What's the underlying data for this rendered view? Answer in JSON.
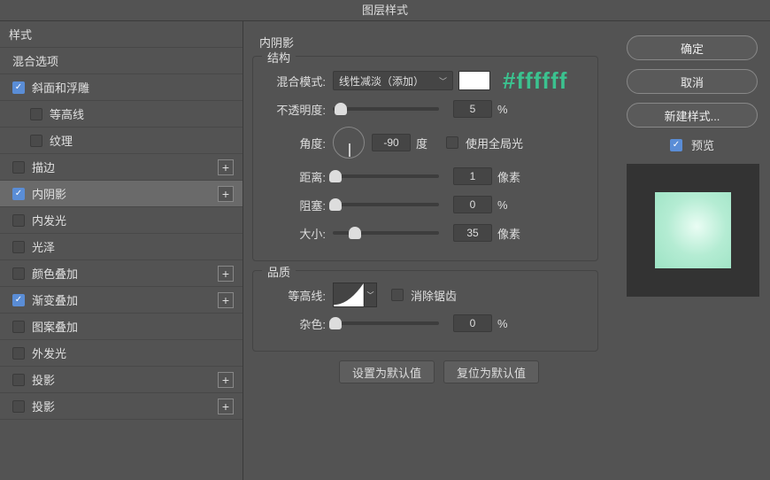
{
  "window_title": "图层样式",
  "sidebar": {
    "header": "样式",
    "blend_options": "混合选项",
    "items": [
      {
        "label": "斜面和浮雕",
        "checked": true,
        "plus": false,
        "sub": false
      },
      {
        "label": "等高线",
        "checked": false,
        "plus": false,
        "sub": true
      },
      {
        "label": "纹理",
        "checked": false,
        "plus": false,
        "sub": true
      },
      {
        "label": "描边",
        "checked": false,
        "plus": true,
        "sub": false
      },
      {
        "label": "内阴影",
        "checked": true,
        "plus": true,
        "sub": false,
        "selected": true
      },
      {
        "label": "内发光",
        "checked": false,
        "plus": false,
        "sub": false
      },
      {
        "label": "光泽",
        "checked": false,
        "plus": false,
        "sub": false
      },
      {
        "label": "颜色叠加",
        "checked": false,
        "plus": true,
        "sub": false
      },
      {
        "label": "渐变叠加",
        "checked": true,
        "plus": true,
        "sub": false
      },
      {
        "label": "图案叠加",
        "checked": false,
        "plus": false,
        "sub": false
      },
      {
        "label": "外发光",
        "checked": false,
        "plus": false,
        "sub": false
      },
      {
        "label": "投影",
        "checked": false,
        "plus": true,
        "sub": false
      },
      {
        "label": "投影",
        "checked": false,
        "plus": true,
        "sub": false
      }
    ]
  },
  "center": {
    "panel_title": "内阴影",
    "structure_title": "结构",
    "blend_mode_label": "混合模式:",
    "blend_mode_value": "线性减淡（添加）",
    "color_hex": "#ffffff",
    "opacity_label": "不透明度:",
    "opacity_value": "5",
    "opacity_unit": "%",
    "angle_label": "角度:",
    "angle_value": "-90",
    "angle_unit": "度",
    "global_light_label": "使用全局光",
    "distance_label": "距离:",
    "distance_value": "1",
    "distance_unit": "像素",
    "spread_label": "阻塞:",
    "spread_value": "0",
    "spread_unit": "%",
    "size_label": "大小:",
    "size_value": "35",
    "size_unit": "像素",
    "quality_title": "品质",
    "contour_label": "等高线:",
    "antialias_label": "消除锯齿",
    "noise_label": "杂色:",
    "noise_value": "0",
    "noise_unit": "%",
    "make_default_btn": "设置为默认值",
    "reset_default_btn": "复位为默认值"
  },
  "right": {
    "ok": "确定",
    "cancel": "取消",
    "new_style": "新建样式...",
    "preview_label": "预览"
  }
}
